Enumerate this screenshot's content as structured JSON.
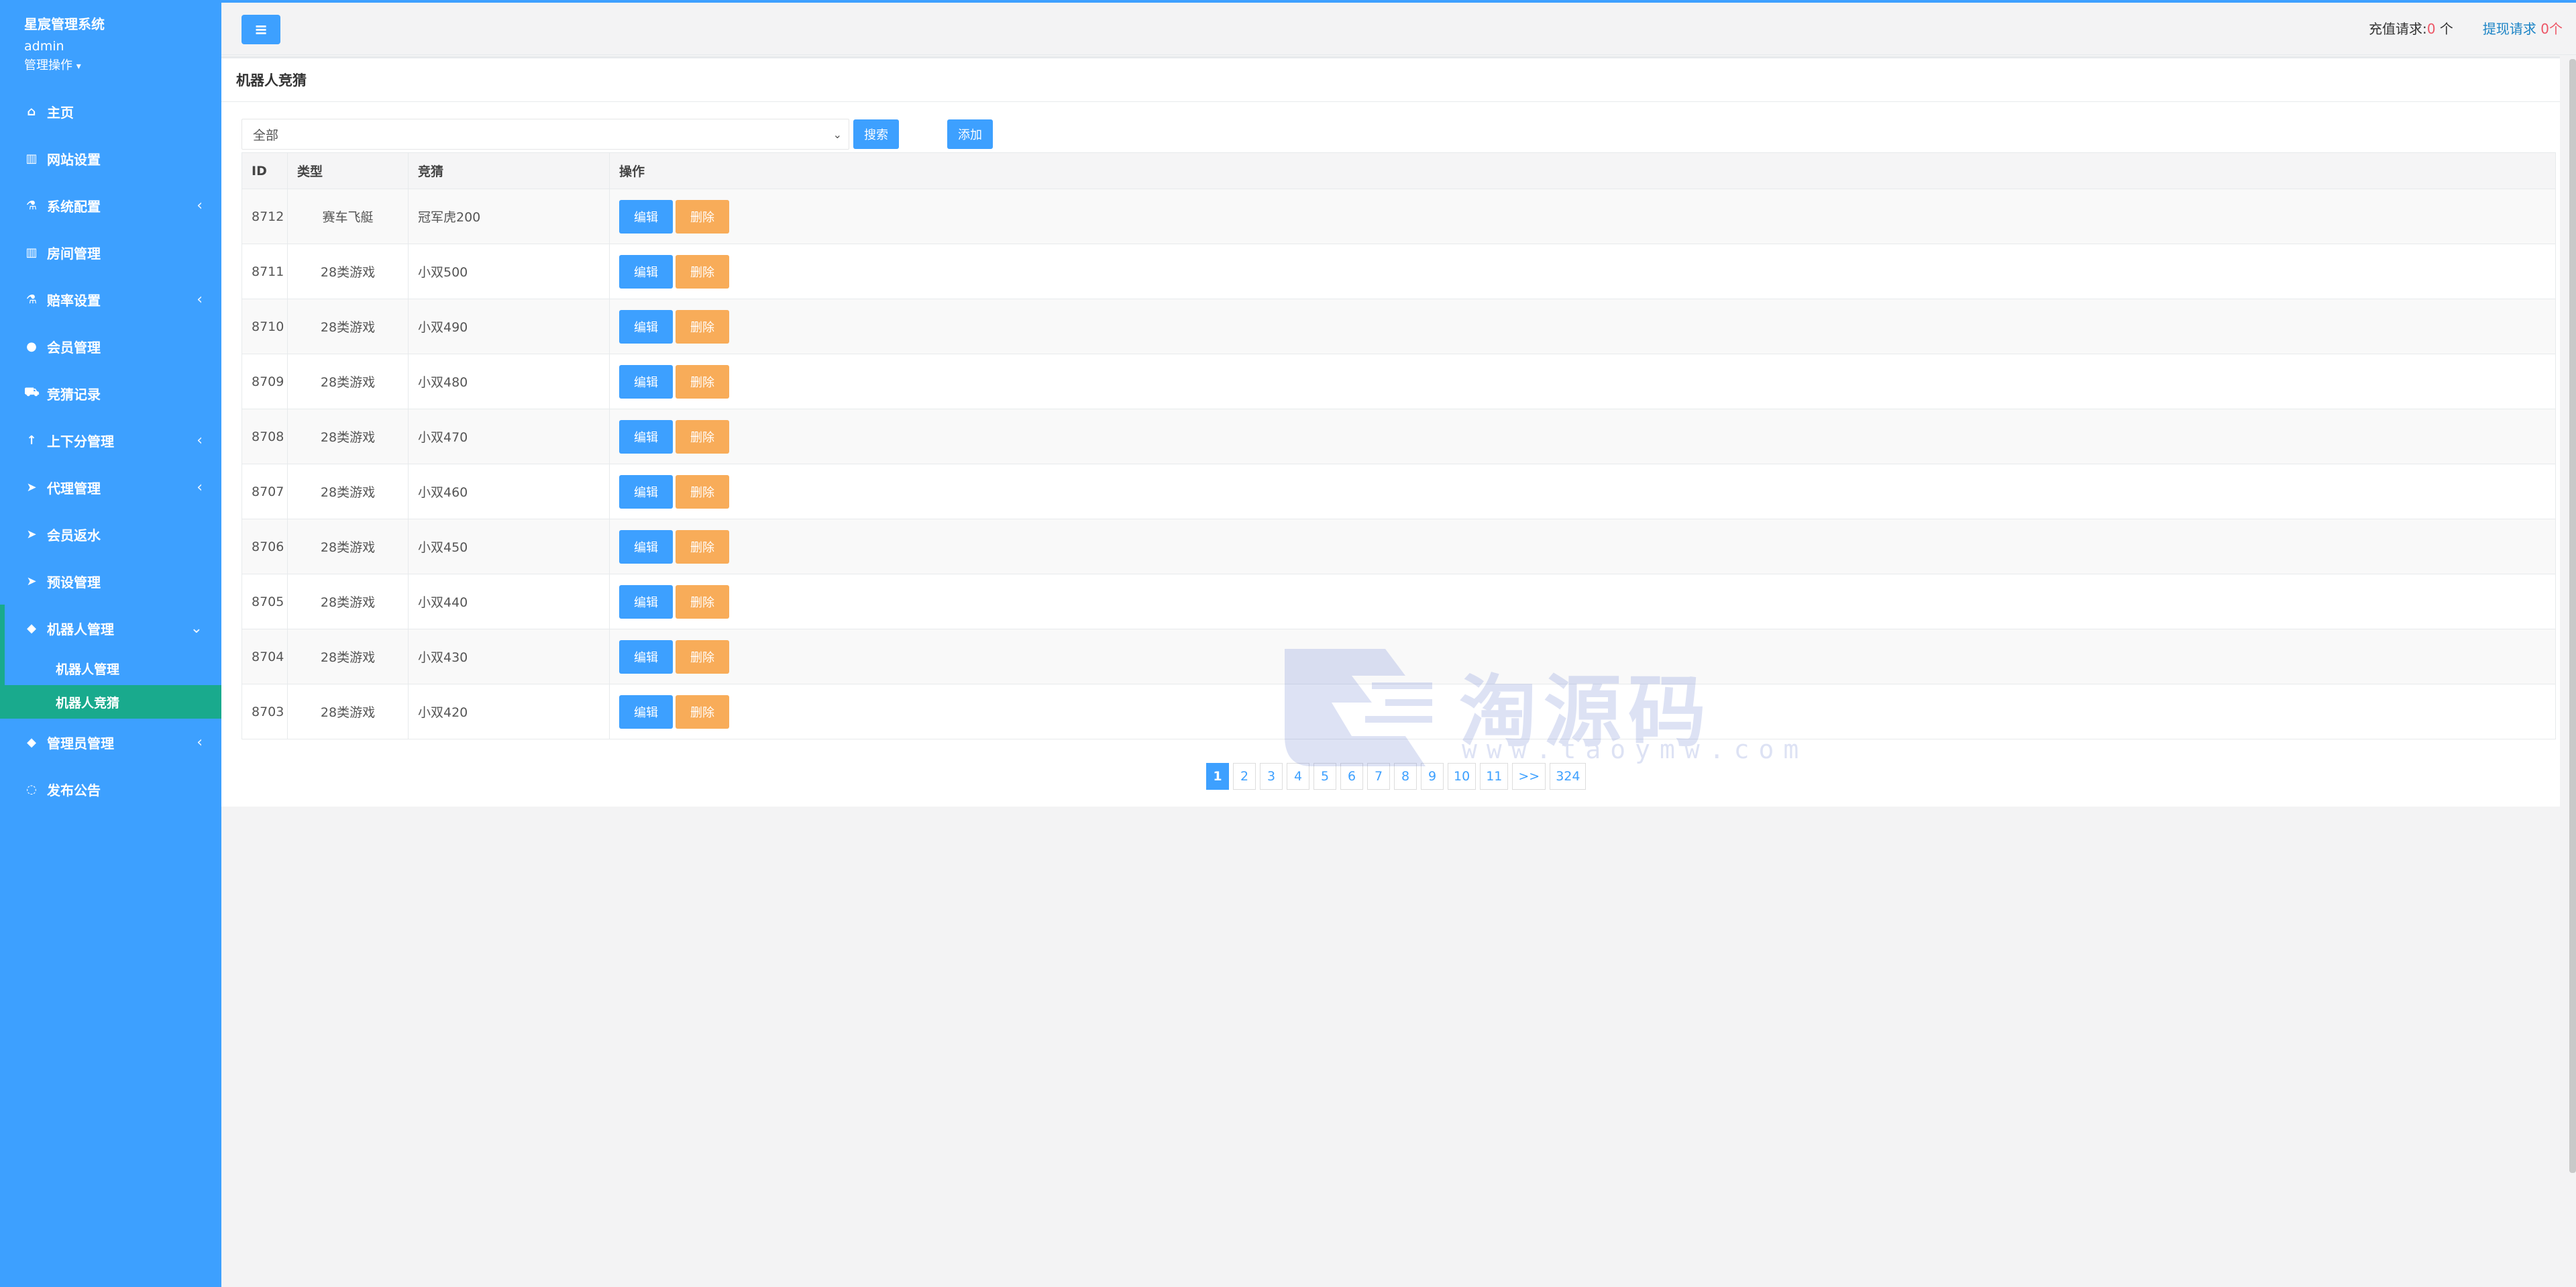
{
  "sidebar": {
    "system_name": "星宸管理系统",
    "username": "admin",
    "ops_label": "管理操作",
    "items": [
      {
        "label": "主页",
        "icon": "home-icon",
        "glyph": "⌂"
      },
      {
        "label": "网站设置",
        "icon": "columns-icon",
        "glyph": "▥"
      },
      {
        "label": "系统配置",
        "icon": "flask-icon",
        "glyph": "⚗",
        "arrow": "‹"
      },
      {
        "label": "房间管理",
        "icon": "columns-icon",
        "glyph": "▥"
      },
      {
        "label": "赔率设置",
        "icon": "flask-icon",
        "glyph": "⚗",
        "arrow": "‹"
      },
      {
        "label": "会员管理",
        "icon": "user-icon",
        "glyph": "●"
      },
      {
        "label": "竞猜记录",
        "icon": "car-icon",
        "glyph": "⛟"
      },
      {
        "label": "上下分管理",
        "icon": "level-up-icon",
        "glyph": "↑",
        "arrow": "‹"
      },
      {
        "label": "代理管理",
        "icon": "paper-plane-icon",
        "glyph": "➤",
        "arrow": "‹"
      },
      {
        "label": "会员返水",
        "icon": "paper-plane-icon",
        "glyph": "➤"
      },
      {
        "label": "预设管理",
        "icon": "paper-plane-icon",
        "glyph": "➤"
      }
    ],
    "robot_group": {
      "label": "机器人管理",
      "icon": "diamond-icon",
      "glyph": "◆",
      "arrow": "⌄",
      "children": [
        "机器人管理",
        "机器人竞猜"
      ]
    },
    "bottom_items": [
      {
        "label": "管理员管理",
        "icon": "diamond-icon",
        "glyph": "◆",
        "arrow": "‹"
      },
      {
        "label": "发布公告",
        "icon": "comment-icon",
        "glyph": "◌"
      }
    ]
  },
  "topbar": {
    "menu_glyph": "≡",
    "recharge_label": "充值请求:",
    "recharge_count": "0",
    "recharge_unit": " 个",
    "withdraw_label": "提现请求",
    "withdraw_count": "0",
    "withdraw_unit": "个"
  },
  "panel": {
    "title": "机器人竞猜",
    "filter_value": "全部",
    "search_label": "搜索",
    "add_label": "添加",
    "columns": [
      "ID",
      "类型",
      "竞猜",
      "操作"
    ],
    "edit_label": "编辑",
    "delete_label": "删除",
    "rows": [
      {
        "id": "8712",
        "type": "赛车飞艇",
        "guess": "冠军虎200"
      },
      {
        "id": "8711",
        "type": "28类游戏",
        "guess": "小双500"
      },
      {
        "id": "8710",
        "type": "28类游戏",
        "guess": "小双490"
      },
      {
        "id": "8709",
        "type": "28类游戏",
        "guess": "小双480"
      },
      {
        "id": "8708",
        "type": "28类游戏",
        "guess": "小双470"
      },
      {
        "id": "8707",
        "type": "28类游戏",
        "guess": "小双460"
      },
      {
        "id": "8706",
        "type": "28类游戏",
        "guess": "小双450"
      },
      {
        "id": "8705",
        "type": "28类游戏",
        "guess": "小双440"
      },
      {
        "id": "8704",
        "type": "28类游戏",
        "guess": "小双430"
      },
      {
        "id": "8703",
        "type": "28类游戏",
        "guess": "小双420"
      }
    ],
    "pages": [
      "1",
      "2",
      "3",
      "4",
      "5",
      "6",
      "7",
      "8",
      "9",
      "10",
      "11",
      ">>",
      "324"
    ],
    "current_page": "1"
  },
  "watermark": {
    "text": "淘源码",
    "url": "www.taoymw.com"
  }
}
